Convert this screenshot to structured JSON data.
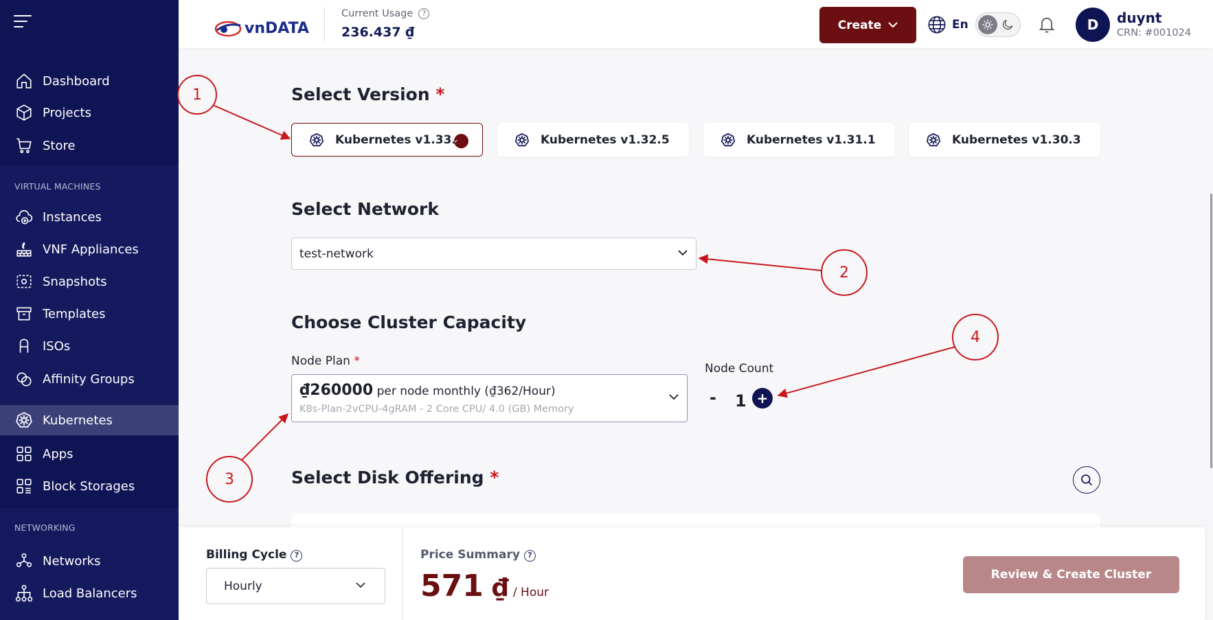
{
  "sidebar": {
    "items_top": [
      {
        "label": "Dashboard",
        "icon": "home-icon"
      },
      {
        "label": "Projects",
        "icon": "cube-icon"
      },
      {
        "label": "Store",
        "icon": "cart-icon"
      }
    ],
    "section_vm": "VIRTUAL MACHINES",
    "items_vm": [
      {
        "label": "Instances",
        "icon": "cloud-plus-icon"
      },
      {
        "label": "VNF Appliances",
        "icon": "firewall-icon"
      },
      {
        "label": "Snapshots",
        "icon": "snapshot-icon"
      },
      {
        "label": "Templates",
        "icon": "archive-icon"
      },
      {
        "label": "ISOs",
        "icon": "disc-icon"
      },
      {
        "label": "Affinity Groups",
        "icon": "affinity-icon"
      }
    ],
    "items_k8s": [
      {
        "label": "Kubernetes",
        "icon": "kubernetes-icon",
        "active": true
      },
      {
        "label": "Apps",
        "icon": "apps-grid-icon"
      },
      {
        "label": "Block Storages",
        "icon": "block-storage-icon"
      }
    ],
    "section_net": "NETWORKING",
    "items_net": [
      {
        "label": "Networks",
        "icon": "network-icon"
      },
      {
        "label": "Load Balancers",
        "icon": "load-balancer-icon"
      }
    ]
  },
  "header": {
    "logo_text": "vnDATA",
    "usage_label": "Current Usage",
    "usage_value": "236.437 ₫",
    "create_label": "Create",
    "language": "En",
    "user": {
      "initial": "D",
      "name": "duynt",
      "crn": "CRN: #001024"
    }
  },
  "main": {
    "version_title": "Select Version",
    "versions": [
      {
        "label": "Kubernetes v1.33.1",
        "selected": true
      },
      {
        "label": "Kubernetes v1.32.5",
        "selected": false
      },
      {
        "label": "Kubernetes v1.31.1",
        "selected": false
      },
      {
        "label": "Kubernetes v1.30.3",
        "selected": false
      }
    ],
    "network_title": "Select Network",
    "network_value": "test-network",
    "capacity_title": "Choose Cluster Capacity",
    "node_plan_label": "Node Plan",
    "node_plan_price": "₫260000",
    "node_plan_price_suffix": "per node monthly (₫362/Hour)",
    "node_plan_desc": "K8s-Plan-2vCPU-4gRAM - 2 Core CPU/ 4.0 (GB) Memory",
    "node_count_label": "Node Count",
    "node_count_minus": "-",
    "node_count_value": "1",
    "node_count_plus": "+",
    "disk_title": "Select Disk Offering"
  },
  "footer": {
    "billing_label": "Billing Cycle",
    "billing_value": "Hourly",
    "price_label": "Price Summary",
    "price_value": "571",
    "price_currency": "₫",
    "price_unit": "/ Hour",
    "review_label": "Review & Create Cluster"
  },
  "annotations": [
    "1",
    "2",
    "3",
    "4"
  ],
  "colors": {
    "sidebar_bg": "#0f1454",
    "accent": "#6b0f12",
    "annotation": "#c8171c",
    "review_button": "#b9878a"
  }
}
